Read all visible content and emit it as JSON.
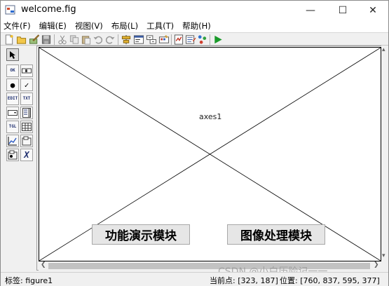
{
  "window": {
    "title": "welcome.fig",
    "controls": {
      "minimize": "—",
      "maximize": "☐",
      "close": "✕"
    }
  },
  "menu": [
    {
      "label": "文件(F)"
    },
    {
      "label": "编辑(E)"
    },
    {
      "label": "视图(V)"
    },
    {
      "label": "布局(L)"
    },
    {
      "label": "工具(T)"
    },
    {
      "label": "帮助(H)"
    }
  ],
  "toolbar_icons": [
    "new-icon",
    "open-icon",
    "edit-icon",
    "save-icon",
    "cut-icon",
    "copy-icon",
    "paste-icon",
    "undo-icon",
    "redo-icon",
    "align-icon",
    "menu-editor-icon",
    "tab-order-icon",
    "toolbar-editor-icon",
    "mfile-editor-icon",
    "property-inspector-icon",
    "object-browser-icon",
    "run-icon"
  ],
  "palette": [
    {
      "name": "select-tool",
      "glyph": ""
    },
    {
      "name": "push-button-tool",
      "glyph": "OK"
    },
    {
      "name": "slider-tool",
      "glyph": ""
    },
    {
      "name": "radio-button-tool",
      "glyph": "●"
    },
    {
      "name": "checkbox-tool",
      "glyph": "✓"
    },
    {
      "name": "edit-text-tool",
      "glyph": "EDIT"
    },
    {
      "name": "static-text-tool",
      "glyph": "TXT"
    },
    {
      "name": "popup-menu-tool",
      "glyph": ""
    },
    {
      "name": "listbox-tool",
      "glyph": ""
    },
    {
      "name": "toggle-button-tool",
      "glyph": "TGL"
    },
    {
      "name": "table-tool",
      "glyph": ""
    },
    {
      "name": "axes-tool",
      "glyph": ""
    },
    {
      "name": "panel-tool",
      "glyph": ""
    },
    {
      "name": "button-group-tool",
      "glyph": ""
    },
    {
      "name": "activex-tool",
      "glyph": "X"
    }
  ],
  "axes": {
    "label": "axes1"
  },
  "buttons": {
    "feature_demo": "功能演示模块",
    "image_processing": "图像处理模块"
  },
  "status": {
    "tag": "标签: figure1",
    "current_point": "当前点:  [323, 187]",
    "position": "位置: [760, 837, 595, 377]"
  },
  "watermark": "CSDN @小白历险记一一"
}
